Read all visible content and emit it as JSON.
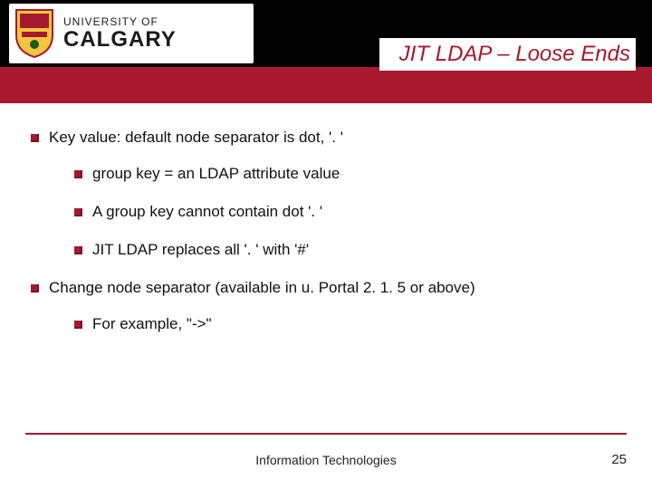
{
  "university": {
    "top": "UNIVERSITY OF",
    "bottom": "CALGARY"
  },
  "slide": {
    "title": "JIT LDAP – Loose Ends"
  },
  "bullets": {
    "b1": "Key value: default node separator is dot, '. '",
    "b1_sub": {
      "s1": "group key = an LDAP attribute value",
      "s2": "A group key cannot contain dot '. '",
      "s3": "JIT LDAP replaces all '. ' with '#'"
    },
    "b2": "Change node separator (available in u. Portal 2. 1. 5 or above)",
    "b2_sub": {
      "s1": "For example, \"->\""
    }
  },
  "footer": {
    "text": "Information Technologies",
    "page": "25"
  }
}
